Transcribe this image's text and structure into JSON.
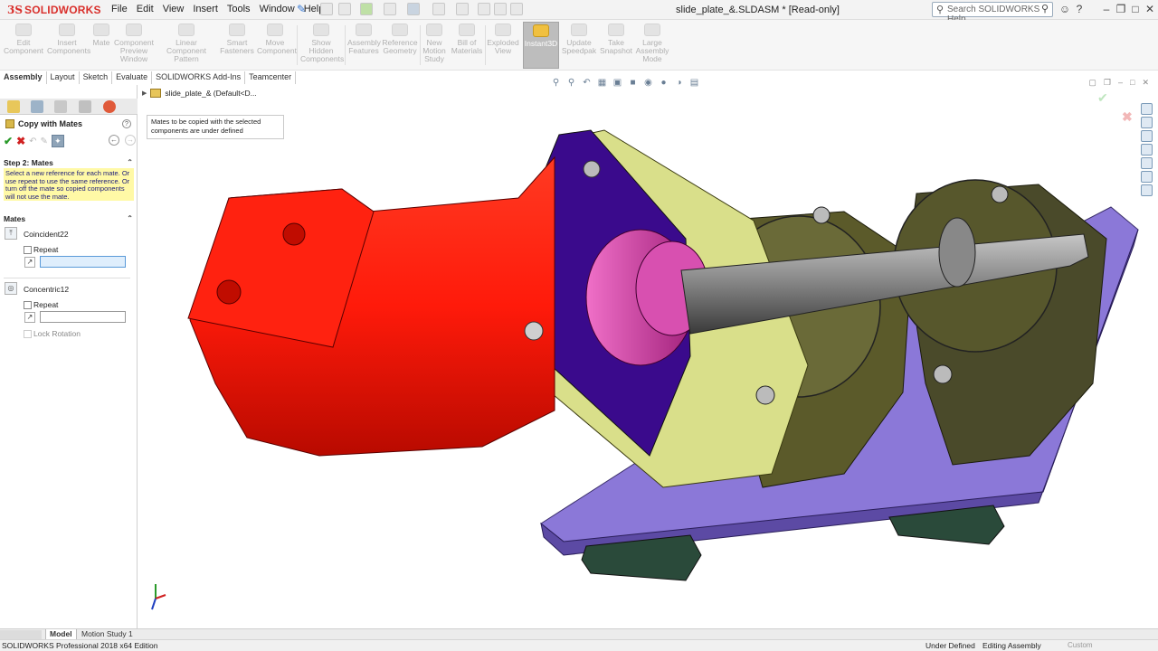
{
  "app": {
    "brand": "SOLIDWORKS",
    "brand_mark": "3S",
    "file_title": "slide_plate_&.SLDASM * [Read-only]",
    "search_placeholder": "Search SOLIDWORKS Help"
  },
  "menu": [
    "File",
    "Edit",
    "View",
    "Insert",
    "Tools",
    "Window",
    "Help"
  ],
  "commands": [
    {
      "label": "Edit Component",
      "active": false
    },
    {
      "label": "Insert Components",
      "active": false
    },
    {
      "label": "Mate",
      "active": false
    },
    {
      "label": "Component Preview Window",
      "active": false
    },
    {
      "label": "Linear Component Pattern",
      "active": false
    },
    {
      "label": "Smart Fasteners",
      "active": false
    },
    {
      "label": "Move Component",
      "active": false
    },
    {
      "label": "Show Hidden Components",
      "active": false
    },
    {
      "label": "Assembly Features",
      "active": false
    },
    {
      "label": "Reference Geometry",
      "active": false
    },
    {
      "label": "New Motion Study",
      "active": false
    },
    {
      "label": "Bill of Materials",
      "active": false
    },
    {
      "label": "Exploded View",
      "active": false
    },
    {
      "label": "Instant3D",
      "active": true
    },
    {
      "label": "Update Speedpak",
      "active": false
    },
    {
      "label": "Take Snapshot",
      "active": false
    },
    {
      "label": "Large Assembly Mode",
      "active": false
    }
  ],
  "tabs": [
    {
      "label": "Assembly",
      "active": true
    },
    {
      "label": "Layout",
      "active": false
    },
    {
      "label": "Sketch",
      "active": false
    },
    {
      "label": "Evaluate",
      "active": false
    },
    {
      "label": "SOLIDWORKS Add-Ins",
      "active": false
    },
    {
      "label": "Teamcenter",
      "active": false
    }
  ],
  "property_manager": {
    "title": "Copy with Mates",
    "step2_header": "Step 2: Mates",
    "step2_message": "Select a new reference for each mate. Or use repeat to use the same reference. Or turn off the mate so copied components will not use the mate.",
    "mates_header": "Mates",
    "mates": [
      {
        "name": "Coincident22",
        "repeat_label": "Repeat",
        "repeat_checked": false,
        "field_value": ""
      },
      {
        "name": "Concentric12",
        "repeat_label": "Repeat",
        "repeat_checked": false,
        "field_value": ""
      }
    ],
    "lock_rotation_label": "Lock Rotation"
  },
  "viewport": {
    "tree_root": "slide_plate_& (Default<D...",
    "tooltip": "Mates to be copied with the selected components are under defined"
  },
  "bottom_tabs": [
    {
      "label": "Model",
      "active": true
    },
    {
      "label": "Motion Study 1",
      "active": false
    }
  ],
  "status": {
    "edition": "SOLIDWORKS Professional 2018 x64 Edition",
    "state": "Under Defined",
    "mode": "Editing Assembly",
    "custom": "Custom"
  },
  "colors": {
    "brand_red": "#d9302c",
    "motor_red": "#ff1a0a",
    "flange_purple": "#3a0a8c",
    "bracket_yellow": "#d9df8a",
    "base_plate": "#8b78d8",
    "housing_olive": "#5b5a2a",
    "selection_blue": "#dfeefc",
    "message_yellow": "#fff9a6"
  }
}
